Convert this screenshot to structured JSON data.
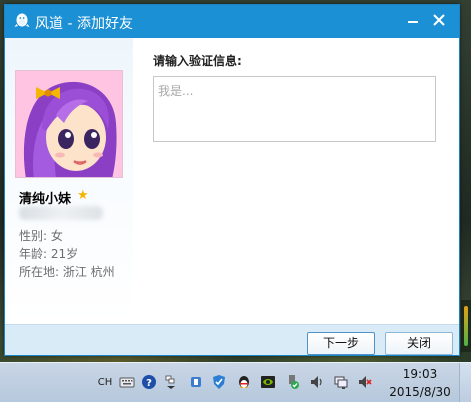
{
  "window": {
    "title": "风道 - 添加好友",
    "minimize_icon": "minimize-icon",
    "close_icon": "close-icon"
  },
  "profile": {
    "nickname": "清纯小妹",
    "badge_icon": "star-icon",
    "gender": "性别: 女",
    "age": "年龄: 21岁",
    "location": "所在地: 浙江 杭州"
  },
  "verify": {
    "label": "请输入验证信息:",
    "placeholder": "我是..."
  },
  "buttons": {
    "next": "下一步",
    "close": "关闭"
  },
  "taskbar": {
    "input_method": "CH",
    "clock_time": "19:03",
    "clock_date": "2015/8/30"
  },
  "colors": {
    "titlebar": "#1b90d4",
    "bottombar": "#d9ebf6",
    "taskbar": "#c9d6e6"
  }
}
